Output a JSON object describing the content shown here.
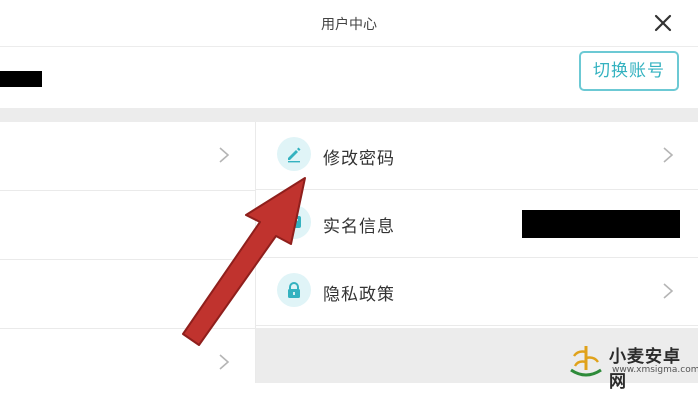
{
  "header": {
    "title": "用户中心",
    "close_icon": "close-icon"
  },
  "account": {
    "switch_label": "切换账号"
  },
  "menu_right": [
    {
      "label": "修改密码",
      "icon": "edit-pencil-icon"
    },
    {
      "label": "实名信息",
      "icon": "id-card-icon"
    },
    {
      "label": "隐私政策",
      "icon": "lock-icon"
    }
  ],
  "watermark": {
    "title": "小麦安卓网",
    "url": "www.xmsigma.com"
  },
  "colors": {
    "accent": "#34b2c0",
    "icon_bg": "#e0f4f7",
    "band": "#ececec",
    "annotation_arrow": "#c0332e"
  }
}
